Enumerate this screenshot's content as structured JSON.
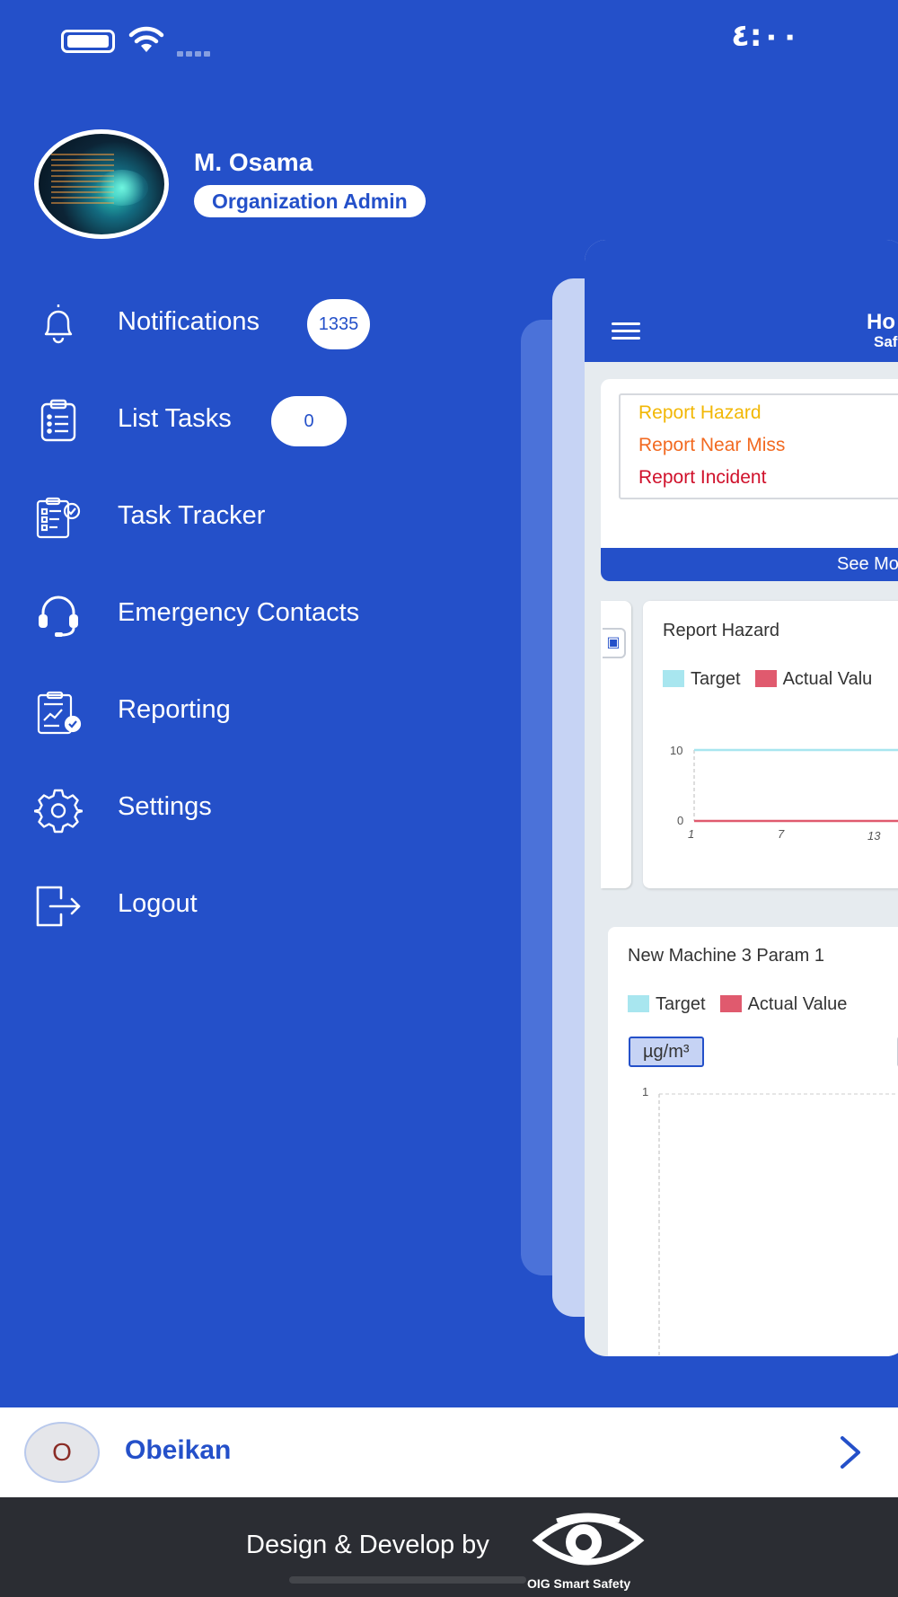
{
  "status_bar": {
    "time": "٤:٠٠"
  },
  "profile": {
    "name": "M. Osama",
    "role": "Organization Admin"
  },
  "menu": {
    "items": [
      {
        "label": "Notifications",
        "badge": "1335",
        "icon": "bell-icon"
      },
      {
        "label": "List Tasks",
        "badge": "0",
        "icon": "clipboard-list-icon"
      },
      {
        "label": "Task Tracker",
        "icon": "task-tracker-icon"
      },
      {
        "label": "Emergency Contacts",
        "icon": "headset-icon"
      },
      {
        "label": "Reporting",
        "icon": "report-chart-icon"
      },
      {
        "label": "Settings",
        "icon": "gear-icon"
      },
      {
        "label": "Logout",
        "icon": "logout-icon"
      }
    ]
  },
  "preview": {
    "header_title": "Ho",
    "header_subtitle": "Saf",
    "report_links": [
      {
        "label": "Report Hazard",
        "color": "#f2b705"
      },
      {
        "label": "Report Near Miss",
        "color": "#f26a21"
      },
      {
        "label": "Report Incident",
        "color": "#d0112b"
      }
    ],
    "see_more": "See Mo",
    "chart1": {
      "title": "Report Hazard",
      "legend": [
        "Target",
        "Actual Valu"
      ],
      "y_ticks": [
        "10",
        "0"
      ],
      "x_ticks": [
        "1",
        "7",
        "13"
      ]
    },
    "chart2": {
      "title": "New Machine 3 Param 1",
      "legend": [
        "Target",
        "Actual Value"
      ],
      "unit": "µg/m³",
      "y_ticks": [
        "1"
      ]
    },
    "colors": {
      "target": "#a8e6ef",
      "actual": "#e05a6e"
    }
  },
  "chart_data": [
    {
      "type": "line",
      "title": "Report Hazard",
      "x": [
        1,
        7,
        13
      ],
      "series": [
        {
          "name": "Target",
          "values": [
            10,
            10,
            10
          ]
        },
        {
          "name": "Actual Valu",
          "values": [
            0,
            0,
            0
          ]
        }
      ],
      "ylim": [
        0,
        10
      ]
    },
    {
      "type": "line",
      "title": "New Machine 3 Param 1",
      "ylabel": "µg/m³",
      "series": [
        {
          "name": "Target",
          "values": []
        },
        {
          "name": "Actual Value",
          "values": []
        }
      ],
      "ylim": [
        0,
        1
      ]
    }
  ],
  "organization": {
    "initial": "O",
    "name": "Obeikan"
  },
  "footer": {
    "text": "Design & Develop by",
    "brand": "OIG Smart Safety"
  }
}
